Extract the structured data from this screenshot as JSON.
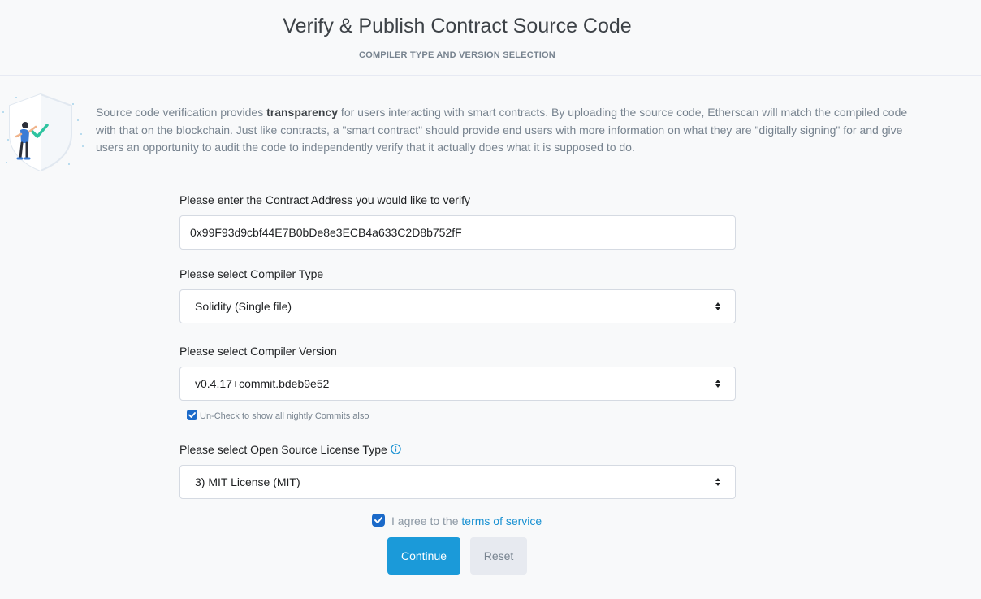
{
  "header": {
    "title": "Verify & Publish Contract Source Code",
    "subtitle": "COMPILER TYPE AND VERSION SELECTION"
  },
  "intro": {
    "text_before": "Source code verification provides ",
    "highlight": "transparency",
    "text_after": " for users interacting with smart contracts. By uploading the source code, Etherscan will match the compiled code with that on the blockchain. Just like contracts, a \"smart contract\" should provide end users with more information on what they are \"digitally signing\" for and give users an opportunity to audit the code to independently verify that it actually does what it is supposed to do."
  },
  "form": {
    "address": {
      "label": "Please enter the Contract Address you would like to verify",
      "value": "0x99F93d9cbf44E7B0bDe8e3ECB4a633C2D8b752fF"
    },
    "compiler_type": {
      "label": "Please select Compiler Type",
      "selected": "Solidity (Single file)"
    },
    "compiler_version": {
      "label": "Please select Compiler Version",
      "selected": "v0.4.17+commit.bdeb9e52",
      "nightly_checkbox_label": "Un-Check to show all nightly Commits also",
      "nightly_checked": true
    },
    "license": {
      "label": "Please select Open Source License Type",
      "selected": "3) MIT License (MIT)"
    },
    "terms": {
      "text": "I agree to the ",
      "link": "terms of service",
      "checked": true
    },
    "buttons": {
      "continue": "Continue",
      "reset": "Reset"
    }
  },
  "colors": {
    "accent": "#1b9ad9",
    "checkbox": "#1b6ac9",
    "link": "#1991d2",
    "muted_text": "#77838f"
  },
  "icons": {
    "illustration": "shield-check-illustration",
    "caret": "select-caret-icon",
    "info": "info-icon"
  }
}
